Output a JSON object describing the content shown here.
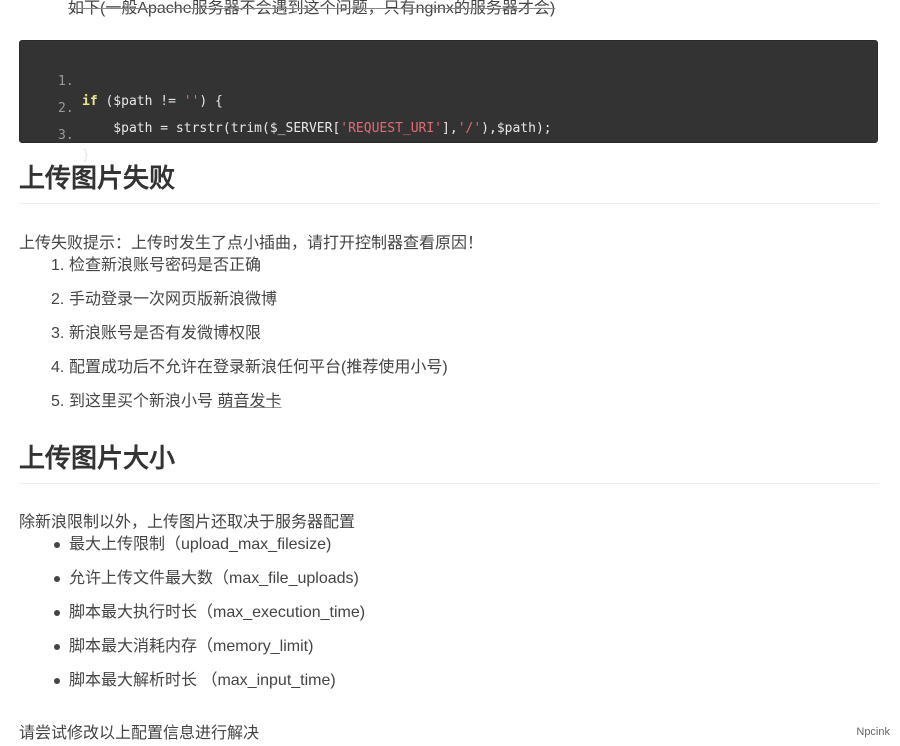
{
  "top_note": "如下(一般Apache服务器不会遇到这个问题，只有nginx的服务器才会)",
  "code": {
    "lines": [
      {
        "num": "1.",
        "kw": "if",
        "pre": " ($path != ",
        "str": "''",
        "post": ") {"
      },
      {
        "num": "2.",
        "pre": "    $path = strstr(trim($_SERVER[",
        "str1": "'REQUEST_URI'",
        "mid": "],",
        "str2": "'/'",
        "post": "),$path);"
      },
      {
        "num": "3.",
        "text": "}"
      }
    ]
  },
  "section1": {
    "title": "上传图片失败",
    "intro": "上传失败提示：上传时发生了点小插曲，请打开控制器查看原因！",
    "items": [
      {
        "num": "1.",
        "text": "检查新浪账号密码是否正确"
      },
      {
        "num": "2.",
        "text": "手动登录一次网页版新浪微博"
      },
      {
        "num": "3.",
        "text": "新浪账号是否有发微博权限"
      },
      {
        "num": "4.",
        "text": "配置成功后不允许在登录新浪任何平台(推荐使用小号)"
      },
      {
        "num": "5.",
        "text": "到这里买个新浪小号 ",
        "link": "萌音发卡"
      }
    ]
  },
  "section2": {
    "title": "上传图片大小",
    "intro": "除新浪限制以外，上传图片还取决于服务器配置",
    "items": [
      "最大上传限制（upload_max_filesize)",
      "允许上传文件最大数（max_file_uploads)",
      "脚本最大执行时长（max_execution_time)",
      "脚本最大消耗内存（memory_limit)",
      "脚本最大解析时长 （max_input_time)"
    ],
    "footer": "请尝试修改以上配置信息进行解决"
  },
  "watermark": "Npcink"
}
